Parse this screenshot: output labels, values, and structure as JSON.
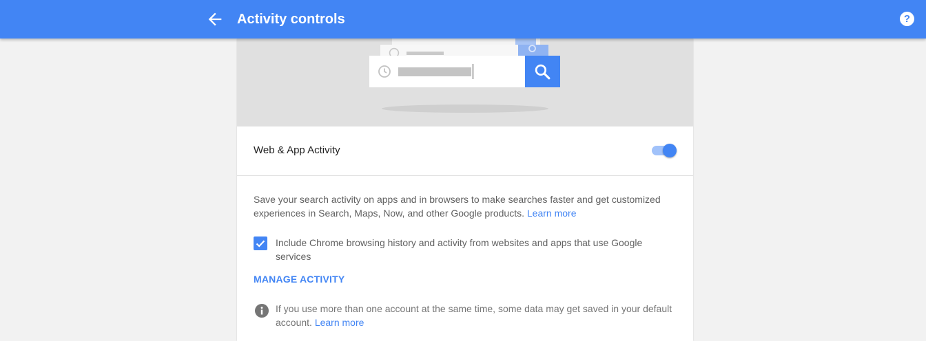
{
  "header": {
    "title": "Activity controls",
    "back_icon": "arrow-back-icon",
    "help_icon": "help-icon",
    "help_glyph": "?"
  },
  "illustration": {
    "icons": [
      "clock-icon",
      "search-icon"
    ]
  },
  "setting": {
    "label": "Web & App Activity",
    "enabled": true,
    "description": "Save your search activity on apps and in browsers to make searches faster and get customized experiences in Search, Maps, Now, and other Google products.",
    "description_link": "Learn more",
    "checkbox": {
      "checked": true,
      "label": "Include Chrome browsing history and activity from websites and apps that use Google services"
    },
    "manage_label": "MANAGE ACTIVITY",
    "info": {
      "text": "If you use more than one account at the same time, some data may get saved in your default account.",
      "link": "Learn more"
    }
  },
  "colors": {
    "brand_blue": "#4285f4",
    "page_bg": "#f2f2f2",
    "hero_bg": "#e0e0e0"
  }
}
